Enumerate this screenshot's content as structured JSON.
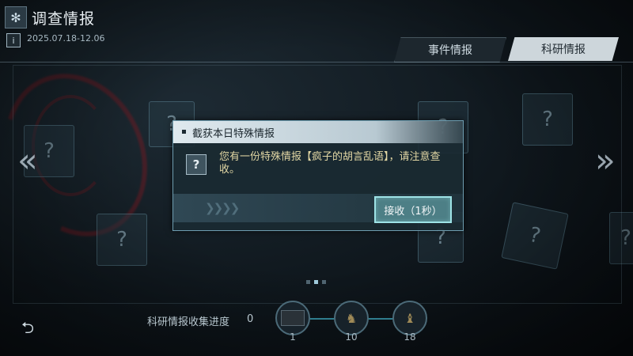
{
  "header": {
    "icon": "gear-icon",
    "title": "调查情报"
  },
  "period": {
    "icon": "info-icon",
    "date_range": "2025.07.18-12.06"
  },
  "tabs": [
    {
      "label": "事件情报",
      "active": false
    },
    {
      "label": "科研情报",
      "active": true
    }
  ],
  "dialog": {
    "title": "截获本日特殊情报",
    "icon": "question-mark-icon",
    "message": "您有一份特殊情报【疯子的胡言乱语】，请注意查收。",
    "accept_label": "接收（1秒）"
  },
  "carousel": {
    "pages": 3,
    "current": 2
  },
  "progress": {
    "label": "科研情报收集进度",
    "value": "0",
    "milestones": [
      {
        "label": "1",
        "icon": "chest-icon"
      },
      {
        "label": "10",
        "icon": "reward-figure-icon"
      },
      {
        "label": "18",
        "icon": "reward-creature-icon"
      }
    ]
  },
  "colors": {
    "accent": "#9ee3e6",
    "button_bg": "#4d7f86",
    "message_text": "#e2d7a4",
    "tab_active_bg": "#cdd6db"
  }
}
